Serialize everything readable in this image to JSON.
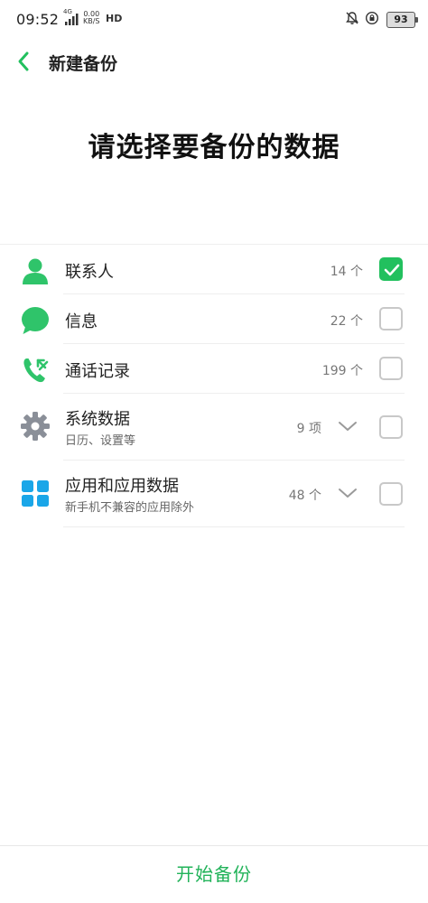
{
  "status_bar": {
    "time": "09:52",
    "network": "4G",
    "speed_value": "0.00",
    "speed_unit": "KB/S",
    "hd": "HD",
    "battery": "93"
  },
  "header": {
    "title": "新建备份"
  },
  "main": {
    "heading": "请选择要备份的数据"
  },
  "list": {
    "items": [
      {
        "label": "联系人",
        "count": "14 个",
        "checked": true,
        "icon": "contact-person-icon"
      },
      {
        "label": "信息",
        "count": "22 个",
        "checked": false,
        "icon": "message-bubble-icon"
      },
      {
        "label": "通话记录",
        "count": "199 个",
        "checked": false,
        "icon": "call-log-icon"
      },
      {
        "label": "系统数据",
        "sublabel": "日历、设置等",
        "count": "9 项",
        "checked": false,
        "icon": "gear-icon"
      },
      {
        "label": "应用和应用数据",
        "sublabel": "新手机不兼容的应用除外",
        "count": "48 个",
        "checked": false,
        "icon": "apps-grid-icon"
      }
    ]
  },
  "footer": {
    "start_label": "开始备份"
  },
  "colors": {
    "accent": "#22c05e",
    "icon_green": "#2fc46a",
    "icon_blue": "#1aa6e8",
    "gear_gray": "#8a8f98"
  }
}
